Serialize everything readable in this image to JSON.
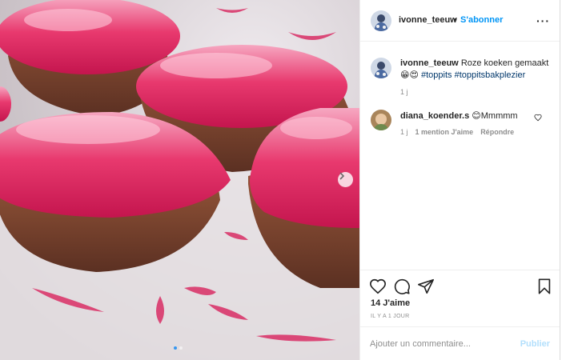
{
  "post": {
    "username": "ivonne_teeuw",
    "separator": "•",
    "follow_label": "S'abonner",
    "more_label": "···",
    "caption_text": "Roze koeken gemaakt",
    "caption_emojis": "😁😍",
    "hashtags": [
      "#toppits",
      "#toppitsbakplezier"
    ],
    "caption_time": "1 j"
  },
  "comment": {
    "username": "diana_koender.s",
    "emoji": "😊",
    "text": "Mmmmm",
    "time": "1 j",
    "likes": "1 mention J'aime",
    "reply": "Répondre"
  },
  "engagement": {
    "likes": "14 J'aime",
    "date": "IL Y A 1 JOUR"
  },
  "composer": {
    "placeholder": "Ajouter un commentaire...",
    "post_label": "Publier"
  },
  "carousel": {
    "slide_index": 1,
    "slide_count": 2
  },
  "colors": {
    "accent": "#0095f6",
    "post_disabled": "#b2dffc",
    "icing": "#e8396e"
  },
  "icons": {
    "like": "heart-icon",
    "comment": "comment-icon",
    "share": "paper-plane-icon",
    "save": "bookmark-icon",
    "next": "chevron-right-icon"
  }
}
